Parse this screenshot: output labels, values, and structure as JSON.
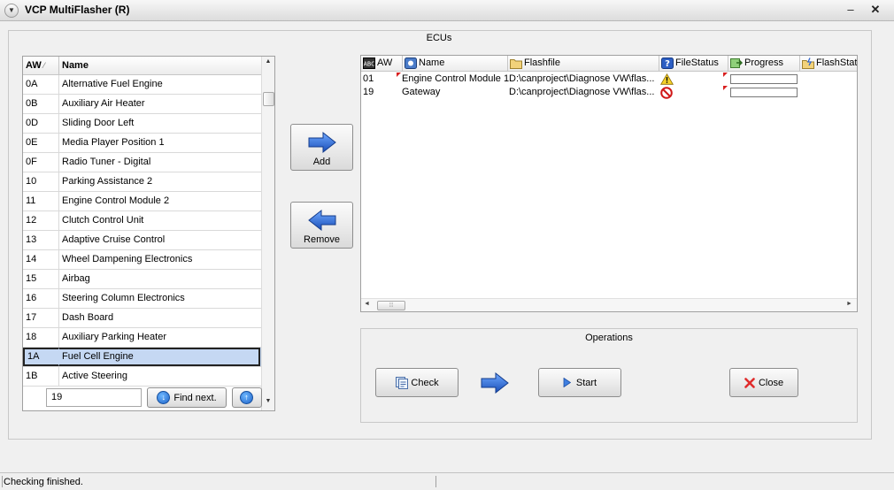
{
  "window": {
    "title": "VCP MultiFlasher (R)"
  },
  "frame_title": "ECUs",
  "ecu_list": {
    "columns": {
      "aw": "AW",
      "name": "Name"
    },
    "rows": [
      {
        "aw": "0A",
        "name": "Alternative Fuel Engine"
      },
      {
        "aw": "0B",
        "name": "Auxiliary Air Heater"
      },
      {
        "aw": "0D",
        "name": "Sliding Door Left"
      },
      {
        "aw": "0E",
        "name": "Media Player Position 1"
      },
      {
        "aw": "0F",
        "name": "Radio Tuner - Digital"
      },
      {
        "aw": "10",
        "name": "Parking Assistance 2"
      },
      {
        "aw": "11",
        "name": "Engine Control Module 2"
      },
      {
        "aw": "12",
        "name": "Clutch Control Unit"
      },
      {
        "aw": "13",
        "name": "Adaptive Cruise Control"
      },
      {
        "aw": "14",
        "name": "Wheel Dampening Electronics"
      },
      {
        "aw": "15",
        "name": "Airbag"
      },
      {
        "aw": "16",
        "name": "Steering Column Electronics"
      },
      {
        "aw": "17",
        "name": "Dash Board"
      },
      {
        "aw": "18",
        "name": "Auxiliary Parking Heater"
      },
      {
        "aw": "1A",
        "name": "Fuel Cell Engine"
      },
      {
        "aw": "1B",
        "name": "Active Steering"
      }
    ],
    "selected_aw": "1A",
    "find_value": "19",
    "find_next_label": "Find next."
  },
  "buttons": {
    "add": "Add",
    "remove": "Remove"
  },
  "flash_grid": {
    "columns": [
      {
        "label": "AW",
        "icon": "list-id-icon"
      },
      {
        "label": "Name",
        "icon": "module-icon"
      },
      {
        "label": "Flashfile",
        "icon": "folder-icon"
      },
      {
        "label": "FileStatus",
        "icon": "help-icon"
      },
      {
        "label": "Progress",
        "icon": "progress-icon"
      },
      {
        "label": "FlashStat",
        "icon": "flash-folder-icon"
      }
    ],
    "rows": [
      {
        "aw": "01",
        "name": "Engine Control Module 1",
        "file": "D:\\canproject\\Diagnose VW\\flas...",
        "status": "warning-icon",
        "progress": 0
      },
      {
        "aw": "19",
        "name": "Gateway",
        "file": "D:\\canproject\\Diagnose VW\\flas...",
        "status": "blocked-icon",
        "progress": 0
      }
    ]
  },
  "operations": {
    "title": "Operations",
    "check": "Check",
    "start": "Start",
    "close": "Close"
  },
  "status": {
    "text": "Checking finished."
  }
}
